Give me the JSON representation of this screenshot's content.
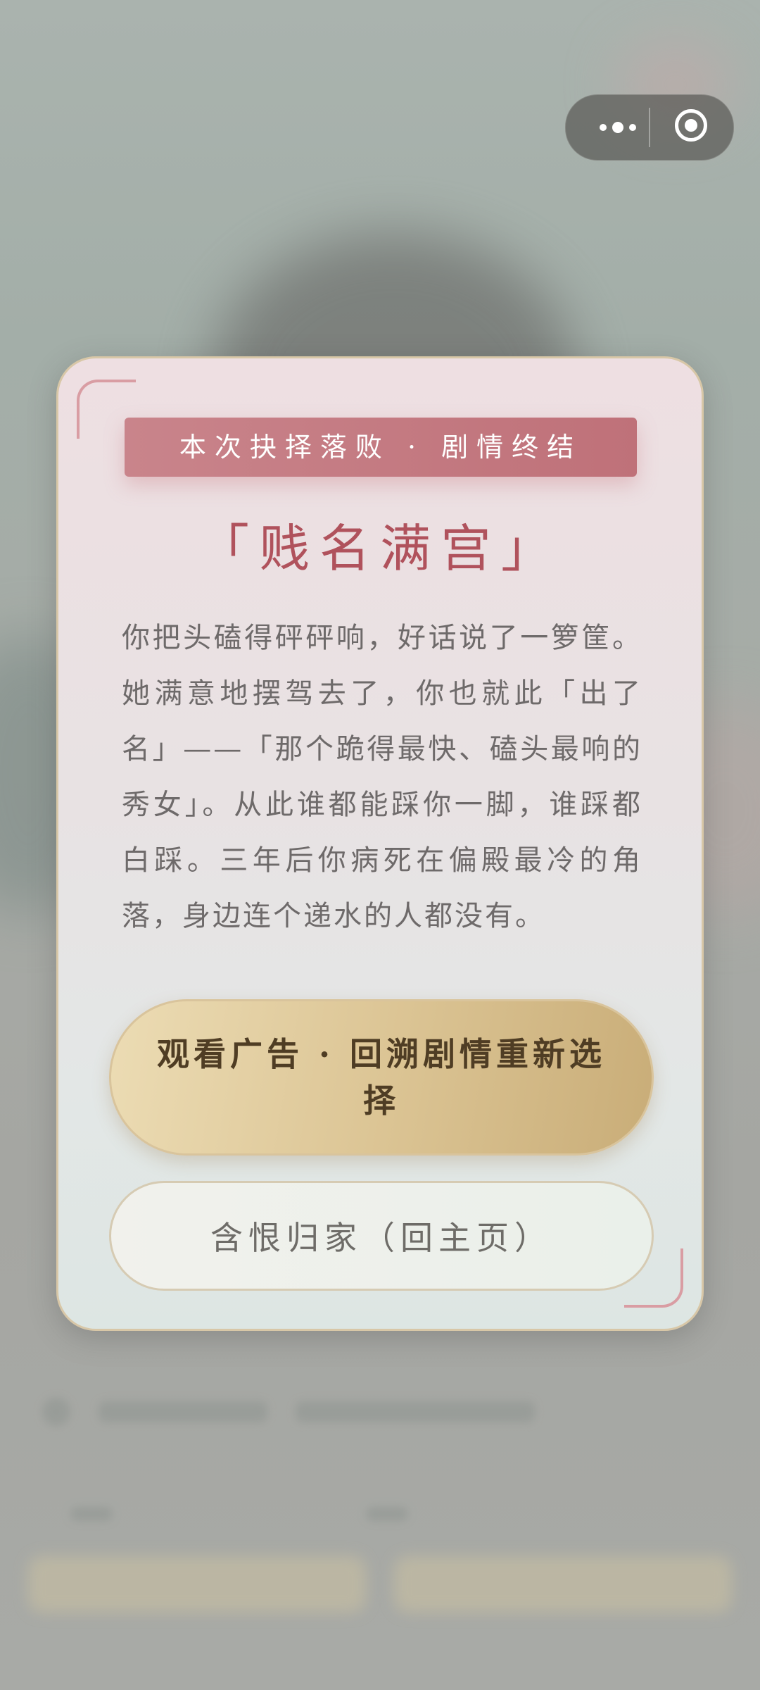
{
  "capsule": {
    "more_icon": "more-dots-icon",
    "close_icon": "target-circle-icon"
  },
  "result": {
    "banner": "本次抉择落败 · 剧情终结",
    "title": "「贱名满宫」",
    "story": "你把头磕得砰砰响，好话说了一箩筐。她满意地摆驾去了，你也就此「出了名」——「那个跪得最快、磕头最响的秀女」。从此谁都能踩你一脚，谁踩都白踩。三年后你病死在偏殿最冷的角落，身边连个递水的人都没有。"
  },
  "actions": {
    "watch_ad_label": "观看广告 · 回溯剧情重新选择",
    "go_home_label": "含恨归家（回主页）"
  },
  "colors": {
    "accent_red": "#c0737b",
    "title_red": "#b0525c",
    "gold": "#d9c49c"
  }
}
